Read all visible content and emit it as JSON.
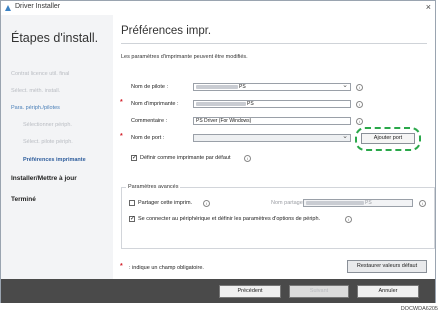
{
  "window": {
    "title": "Driver Installer",
    "close": "×"
  },
  "sidebar": {
    "heading": "Étapes d'install.",
    "items": [
      {
        "label": "Contrat licence util. final"
      },
      {
        "label": "Sélect. méth. install."
      },
      {
        "label": "Para. périph./pilotes"
      },
      {
        "label": "Sélectionner périph."
      },
      {
        "label": "Sélect. pilote périph."
      },
      {
        "label": "Préférences imprimante"
      },
      {
        "label": "Installer/Mettre à jour"
      },
      {
        "label": "Terminé"
      }
    ]
  },
  "main": {
    "title": "Préférences impr.",
    "intro": "Les paramètres d'imprimante peuvent être modifiés.",
    "driver_label": "Nom de pilote :",
    "driver_value": "PS",
    "printer_label": "Nom d'imprimante :",
    "printer_value": "PS",
    "comment_label": "Commentaire :",
    "comment_value": "PS Driver (For Windows)",
    "port_label": "Nom de port :",
    "port_value": "",
    "add_port": "Ajouter port",
    "default_printer": "Définir comme imprimante par défaut",
    "advanced_title": "Paramètres avancés",
    "share_label": "Partager cette imprim.",
    "share_name_label": "Nom partage :",
    "share_name_value": "PS",
    "connect_label": "Se connecter au périphérique et définir les paramètres d'options de périph.",
    "required_note": ": indique un champ obligatoire.",
    "restore": "Restaurer valeurs défaut"
  },
  "footer": {
    "back": "Précédent",
    "next": "Suivant",
    "cancel": "Annuler"
  },
  "doc_code": "DOCWDA6205",
  "info_glyph": "i",
  "required_glyph": "*",
  "check_glyph": "✓",
  "colors": {
    "required": "#d3212b",
    "highlight": "#2aa84a",
    "active_step": "#2e5d9c",
    "footer": "#4a4a4a"
  }
}
